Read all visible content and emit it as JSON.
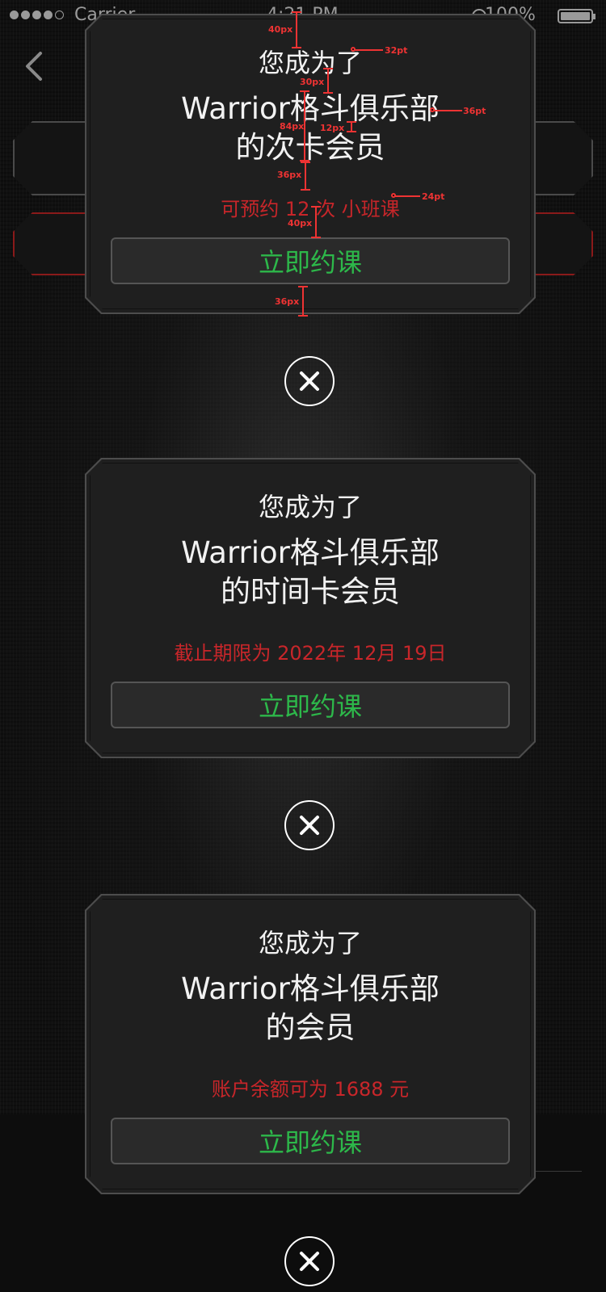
{
  "status_bar": {
    "carrier": "Carrier",
    "time": "4:21 PM",
    "battery": "100%"
  },
  "background_page": {
    "back_icon": "chevron-left-icon"
  },
  "cards": [
    {
      "intro": "您成为了",
      "title_line1": "Warrior格斗俱乐部",
      "title_line2": "的次卡会员",
      "detail": "可预约 12 次 小班课",
      "button": "立即约课"
    },
    {
      "intro": "您成为了",
      "title_line1": "Warrior格斗俱乐部",
      "title_line2": "的时间卡会员",
      "detail": "截止期限为 2022年 12月 19日",
      "button": "立即约课"
    },
    {
      "intro": "您成为了",
      "title_line1": "Warrior格斗俱乐部",
      "title_line2": "的会员",
      "detail": "账户余额可为 1688 元",
      "button": "立即约课"
    }
  ],
  "close_icon": "close-icon",
  "annotations": {
    "a1": "40px",
    "a2": "32pt",
    "a3": "30px",
    "a4": "36pt",
    "a5": "84px",
    "a6": "12px",
    "a7": "36px",
    "a8": "24pt",
    "a9": "40px",
    "a10": "36px"
  },
  "colors": {
    "accent_green": "#2db84a",
    "detail_red": "#c8262a",
    "card_bg": "#1f1f1f",
    "annotation_red": "#ee3333"
  }
}
